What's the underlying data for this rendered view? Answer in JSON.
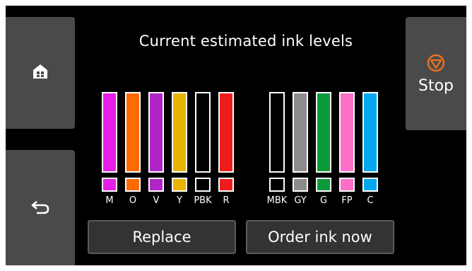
{
  "title": "Current estimated ink levels",
  "stop_label": "Stop",
  "buttons": {
    "replace": "Replace",
    "order": "Order ink now"
  },
  "icons": {
    "home": "home-icon",
    "back": "back-arrow-icon",
    "stop": "stop-icon"
  },
  "colors": {
    "stop_accent": "#e8731f",
    "button_gray": "#4a4a4a"
  },
  "inks": [
    {
      "label": "M",
      "color": "#e51fe5",
      "level": 1.0
    },
    {
      "label": "O",
      "color": "#ff6a00",
      "level": 1.0
    },
    {
      "label": "V",
      "color": "#b024c8",
      "level": 1.0
    },
    {
      "label": "Y",
      "color": "#e8b400",
      "level": 1.0
    },
    {
      "label": "PBK",
      "color": "#000000",
      "level": 1.0
    },
    {
      "label": "R",
      "color": "#ee1c1c",
      "level": 1.0
    },
    {
      "label": "MBK",
      "color": "#000000",
      "level": 1.0
    },
    {
      "label": "GY",
      "color": "#8c8c8c",
      "level": 1.0
    },
    {
      "label": "G",
      "color": "#0a9a3a",
      "level": 1.0
    },
    {
      "label": "FP",
      "color": "#ff6ec7",
      "level": 1.0
    },
    {
      "label": "C",
      "color": "#00a8f0",
      "level": 1.0
    }
  ]
}
